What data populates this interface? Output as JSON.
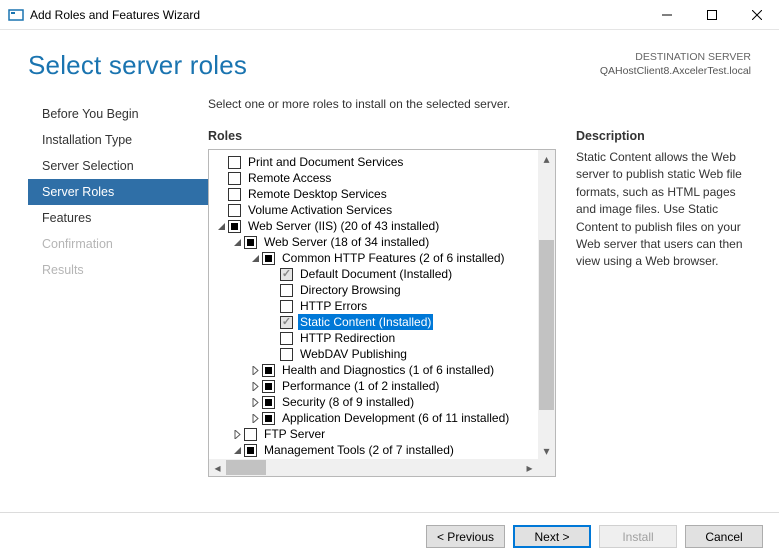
{
  "window": {
    "title": "Add Roles and Features Wizard"
  },
  "header": {
    "title": "Select server roles",
    "destination_label": "DESTINATION SERVER",
    "destination_value": "QAHostClient8.AxcelerTest.local"
  },
  "nav": {
    "items": [
      {
        "label": "Before You Begin",
        "state": "normal"
      },
      {
        "label": "Installation Type",
        "state": "normal"
      },
      {
        "label": "Server Selection",
        "state": "normal"
      },
      {
        "label": "Server Roles",
        "state": "active"
      },
      {
        "label": "Features",
        "state": "normal"
      },
      {
        "label": "Confirmation",
        "state": "disabled"
      },
      {
        "label": "Results",
        "state": "disabled"
      }
    ]
  },
  "main": {
    "instruction": "Select one or more roles to install on the selected server.",
    "roles_heading": "Roles",
    "description_heading": "Description",
    "description_text": "Static Content allows the Web server to publish static Web file formats, such as HTML pages and image files. Use Static Content to publish files on your Web server that users can then view using a Web browser."
  },
  "tree": [
    {
      "indent": 0,
      "expander": "none",
      "check": "empty",
      "label": "Print and Document Services"
    },
    {
      "indent": 0,
      "expander": "none",
      "check": "empty",
      "label": "Remote Access"
    },
    {
      "indent": 0,
      "expander": "none",
      "check": "empty",
      "label": "Remote Desktop Services"
    },
    {
      "indent": 0,
      "expander": "none",
      "check": "empty",
      "label": "Volume Activation Services"
    },
    {
      "indent": 0,
      "expander": "open",
      "check": "partial",
      "label": "Web Server (IIS) (20 of 43 installed)"
    },
    {
      "indent": 1,
      "expander": "open",
      "check": "partial",
      "label": "Web Server (18 of 34 installed)"
    },
    {
      "indent": 2,
      "expander": "open",
      "check": "partial",
      "label": "Common HTTP Features (2 of 6 installed)"
    },
    {
      "indent": 3,
      "expander": "none",
      "check": "checked-locked",
      "label": "Default Document (Installed)"
    },
    {
      "indent": 3,
      "expander": "none",
      "check": "empty",
      "label": "Directory Browsing"
    },
    {
      "indent": 3,
      "expander": "none",
      "check": "empty",
      "label": "HTTP Errors"
    },
    {
      "indent": 3,
      "expander": "none",
      "check": "checked-locked",
      "label": "Static Content (Installed)",
      "selected": true
    },
    {
      "indent": 3,
      "expander": "none",
      "check": "empty",
      "label": "HTTP Redirection"
    },
    {
      "indent": 3,
      "expander": "none",
      "check": "empty",
      "label": "WebDAV Publishing"
    },
    {
      "indent": 2,
      "expander": "closed",
      "check": "partial",
      "label": "Health and Diagnostics (1 of 6 installed)"
    },
    {
      "indent": 2,
      "expander": "closed",
      "check": "partial",
      "label": "Performance (1 of 2 installed)"
    },
    {
      "indent": 2,
      "expander": "closed",
      "check": "partial",
      "label": "Security (8 of 9 installed)"
    },
    {
      "indent": 2,
      "expander": "closed",
      "check": "partial",
      "label": "Application Development (6 of 11 installed)"
    },
    {
      "indent": 1,
      "expander": "closed",
      "check": "empty",
      "label": "FTP Server"
    },
    {
      "indent": 1,
      "expander": "open",
      "check": "partial",
      "label": "Management Tools (2 of 7 installed)"
    }
  ],
  "footer": {
    "previous": "< Previous",
    "next": "Next >",
    "install": "Install",
    "cancel": "Cancel"
  }
}
